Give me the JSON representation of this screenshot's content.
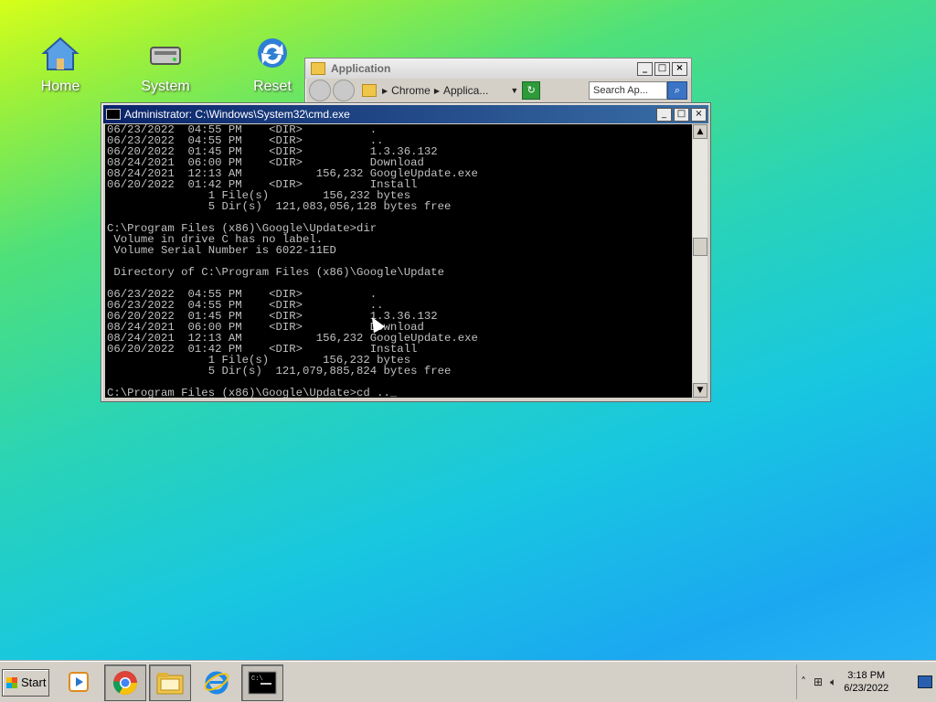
{
  "desktop": {
    "icons": [
      {
        "label": "Home",
        "icon": "home-icon"
      },
      {
        "label": "System",
        "icon": "drive-icon"
      },
      {
        "label": "Reset",
        "icon": "refresh-icon"
      }
    ]
  },
  "explorer": {
    "title": "Application",
    "breadcrumb": [
      "Chrome",
      "Applica..."
    ],
    "search_placeholder": "Search Ap..."
  },
  "cmd": {
    "title": "Administrator: C:\\Windows\\System32\\cmd.exe",
    "lines": [
      "06/23/2022  04:55 PM    <DIR>          .",
      "06/23/2022  04:55 PM    <DIR>          ..",
      "06/20/2022  01:45 PM    <DIR>          1.3.36.132",
      "08/24/2021  06:00 PM    <DIR>          Download",
      "08/24/2021  12:13 AM           156,232 GoogleUpdate.exe",
      "06/20/2022  01:42 PM    <DIR>          Install",
      "               1 File(s)        156,232 bytes",
      "               5 Dir(s)  121,083,056,128 bytes free",
      "",
      "C:\\Program Files (x86)\\Google\\Update>dir",
      " Volume in drive C has no label.",
      " Volume Serial Number is 6022-11ED",
      "",
      " Directory of C:\\Program Files (x86)\\Google\\Update",
      "",
      "06/23/2022  04:55 PM    <DIR>          .",
      "06/23/2022  04:55 PM    <DIR>          ..",
      "06/20/2022  01:45 PM    <DIR>          1.3.36.132",
      "08/24/2021  06:00 PM    <DIR>          Download",
      "08/24/2021  12:13 AM           156,232 GoogleUpdate.exe",
      "06/20/2022  01:42 PM    <DIR>          Install",
      "               1 File(s)        156,232 bytes",
      "               5 Dir(s)  121,079,885,824 bytes free",
      "",
      "C:\\Program Files (x86)\\Google\\Update>cd .._"
    ]
  },
  "taskbar": {
    "start_label": "Start",
    "apps": [
      {
        "name": "media-player-icon"
      },
      {
        "name": "chrome-icon"
      },
      {
        "name": "file-explorer-icon"
      },
      {
        "name": "internet-explorer-icon"
      },
      {
        "name": "cmd-icon"
      }
    ],
    "tray": {
      "time": "3:18 PM",
      "date": "6/23/2022"
    }
  },
  "colors": {
    "title_active": "#0a246a",
    "console_bg": "#000000",
    "console_fg": "#c0c0c0"
  }
}
